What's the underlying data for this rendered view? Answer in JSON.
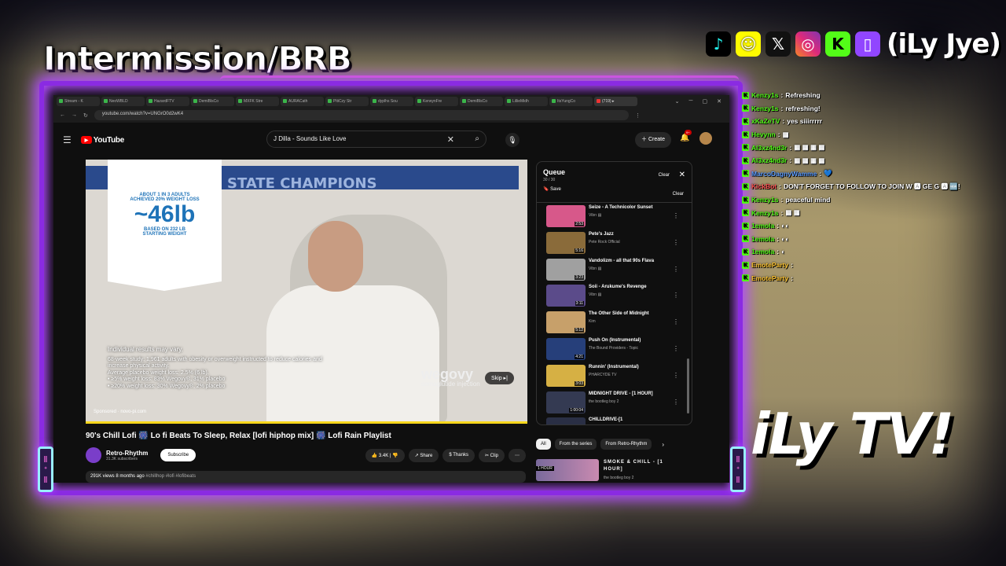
{
  "overlay": {
    "title": "Intermission/BRB",
    "handle": "(iLy Jye)",
    "brand": "iLy TV!",
    "social_icons": [
      "tiktok-icon",
      "snapchat-icon",
      "x-icon",
      "instagram-icon",
      "kick-icon",
      "twitch-icon"
    ],
    "accent": "#b14bff"
  },
  "browser": {
    "tabs": [
      "Stream - K",
      "NeoWBLD",
      "HazardFTV",
      "DemiBlsCo",
      "MXFK Stre",
      "AURACath",
      "PltiCzy Str",
      "dyplhs Sou",
      "KerwynFre",
      "DemiBlsCo",
      "LillieMidh",
      "ItsYungCo",
      "(719) ▸"
    ],
    "url": "youtube.com/watch?v=UNGrO0d2wK4"
  },
  "youtube": {
    "logo": "YouTube",
    "search_value": "J Dilla - Sounds Like Love",
    "create_label": "Create",
    "notif_count": "9+",
    "ad": {
      "card_line1": "ABOUT 1 IN 3 ADULTS",
      "card_line2": "ACHIEVED 20% WEIGHT LOSS",
      "card_big": "~46lb",
      "card_line3": "BASED ON 232 LB",
      "card_line4": "STARTING WEIGHT",
      "banner": "STATE CHAMPIONS",
      "disclaimer": "Individual results may vary.",
      "study": "68-week study: 1,961 adults with obesity or overweight instructed to reduce calories and increase physical activity.",
      "placebo": "Average placebo weight loss: 2.5% (6 lb).",
      "stat1": "• ≥5% weight loss: 83% Wegovy®, 31% placebo",
      "stat2": "• ≥20% weight loss: 30% Wegovy®, 2% placebo",
      "brand_name": "wegovy",
      "brand_sub": "semaglutide injection",
      "skip_label": "Skip ▸|",
      "sponsored": "Sponsored · novo-pi.com"
    },
    "video_title": "90's Chill Lofi 🎆 Lo fi Beats To Sleep, Relax [lofi hiphop mix] 🎆 Lofi Rain Playlist",
    "channel_name": "Retro-Rhythm",
    "channel_subs": "31.3K subscribers",
    "subscribe_label": "Subscribe",
    "like_count": "3.4K",
    "share_label": "Share",
    "thanks_label": "Thanks",
    "clip_label": "Clip",
    "more_label": "⋯",
    "desc_views": "291K views  8 months ago",
    "desc_tags": "#chillhop #lofi #lofibeats",
    "queue": {
      "title": "Queue",
      "count": "30 / 30",
      "save_label": "Save",
      "clear_label": "Clear",
      "items": [
        {
          "title": "Seize - A Technicolor Sunset",
          "channel": "Vibrı ▤",
          "duration": "2:53",
          "color": "#d7588a"
        },
        {
          "title": "Pete's Jazz",
          "channel": "Pete Rock Official",
          "duration": "5:16",
          "color": "#8a6b3a"
        },
        {
          "title": "Vandolizm - all that 90s Flava",
          "channel": "Vibrı ▤",
          "duration": "3:23",
          "color": "#a0a0a0"
        },
        {
          "title": "Soii - Arukume's Revenge",
          "channel": "Vibrı ▤",
          "duration": "3:11",
          "color": "#5b4b8a"
        },
        {
          "title": "The Other Side of Midnight",
          "channel": "Kim",
          "duration": "5:12",
          "color": "#c7a06a"
        },
        {
          "title": "Push On (Instrumental)",
          "channel": "The Bound Providers - Topic",
          "duration": "4:21",
          "color": "#263f7a"
        },
        {
          "title": "Runnin' (Instrumental)",
          "channel": "PHARCYDE TV",
          "duration": "3:03",
          "color": "#d6b044"
        },
        {
          "title": "MIDNIGHT DRIVE - [1 HOUR]",
          "channel": "the bootleg boy 2",
          "duration": "1:00:04",
          "color": "#343a52"
        },
        {
          "title": "CHILLDRIVE-[1",
          "channel": "",
          "duration": "",
          "color": "#2a2f45"
        }
      ]
    },
    "chips": [
      "All",
      "From the series",
      "From Retro-Rhythm"
    ],
    "rec": {
      "title": "SMOKE & CHILL - [1 HOUR]",
      "channel": "the bootleg boy 2",
      "badge": "1 HOUR"
    }
  },
  "chat": [
    {
      "user": "Kenzy1s",
      "msg": "Refreshing",
      "cls": ""
    },
    {
      "user": "Kenzy1s",
      "msg": "refreshing!",
      "cls": ""
    },
    {
      "user": "xKaZeTV",
      "msg": "yes siiirrrrr",
      "cls": ""
    },
    {
      "user": "Hevynn",
      "msg": "▦",
      "cls": ""
    },
    {
      "user": "Al3xz4nd3r",
      "msg": "▦ ▦ ▦ ▦",
      "cls": ""
    },
    {
      "user": "Al3xz4nd3r",
      "msg": "▦ ▦ ▦ ▦",
      "cls": ""
    },
    {
      "user": "MarcoDagnyWamme",
      "msg": "💙",
      "cls": "blue"
    },
    {
      "user": "KickBot",
      "msg": "DON'T FORGET TO FOLLOW TO JOIN W 🅰 GE G 🅰 🆕!",
      "cls": "pink"
    },
    {
      "user": "Kenzy1s",
      "msg": "peaceful mind",
      "cls": ""
    },
    {
      "user": "Kenzy1s",
      "msg": "▦ ▦",
      "cls": ""
    },
    {
      "user": "1emola",
      "msg": "◐◐",
      "cls": ""
    },
    {
      "user": "1emola",
      "msg": "◐◐",
      "cls": ""
    },
    {
      "user": "1emola",
      "msg": "◐",
      "cls": ""
    },
    {
      "user": "EmoteParty",
      "msg": "",
      "cls": "gold"
    },
    {
      "user": "EmoteParty",
      "msg": "",
      "cls": "gold"
    }
  ]
}
